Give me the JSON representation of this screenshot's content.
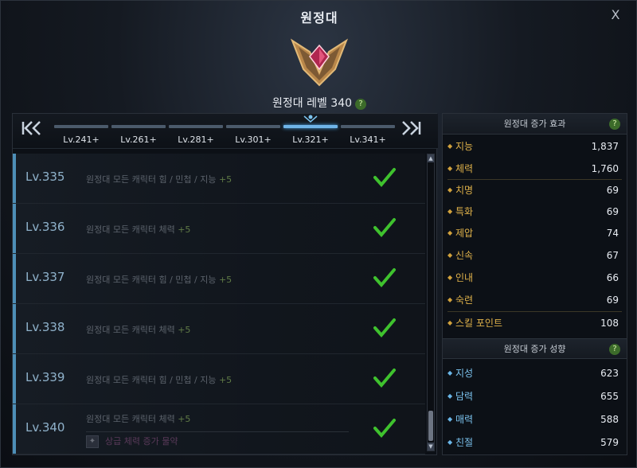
{
  "window": {
    "title": "원정대",
    "close_label": "X"
  },
  "header": {
    "level_text": "원정대 레벨 340",
    "help": "?"
  },
  "tabs": {
    "first": "K",
    "prev": "<",
    "next": ">",
    "last": "K",
    "items": [
      {
        "label": "Lv.241+"
      },
      {
        "label": "Lv.261+"
      },
      {
        "label": "Lv.281+"
      },
      {
        "label": "Lv.301+"
      },
      {
        "label": "Lv.321+",
        "active": true
      },
      {
        "label": "Lv.341+"
      }
    ]
  },
  "rows": [
    {
      "level": "Lv.335",
      "desc": "원정대 모든 캐릭터 힘 / 민첩 / 지능",
      "bonus": "+5",
      "done": true
    },
    {
      "level": "Lv.336",
      "desc": "원정대 모든 캐릭터 체력",
      "bonus": "+5",
      "done": true
    },
    {
      "level": "Lv.337",
      "desc": "원정대 모든 캐릭터 힘 / 민첩 / 지능",
      "bonus": "+5",
      "done": true
    },
    {
      "level": "Lv.338",
      "desc": "원정대 모든 캐릭터 체력",
      "bonus": "+5",
      "done": true
    },
    {
      "level": "Lv.339",
      "desc": "원정대 모든 캐릭터 힘 / 민첩 / 지능",
      "bonus": "+5",
      "done": true
    },
    {
      "level": "Lv.340",
      "desc": "원정대 모든 캐릭터 체력",
      "bonus": "+5",
      "done": true,
      "extra": "상급 체력 증가 물약"
    }
  ],
  "scrollbar": {
    "up": "▲",
    "down": "▼"
  },
  "effects": {
    "title": "원정대 증가 효과",
    "help": "?",
    "stats": [
      {
        "name": "지능",
        "value": "1,837"
      },
      {
        "name": "체력",
        "value": "1,760"
      },
      {
        "name": "치명",
        "value": "69"
      },
      {
        "name": "특화",
        "value": "69"
      },
      {
        "name": "제압",
        "value": "74"
      },
      {
        "name": "신속",
        "value": "67"
      },
      {
        "name": "인내",
        "value": "66"
      },
      {
        "name": "숙련",
        "value": "69"
      },
      {
        "name": "스킬 포인트",
        "value": "108"
      }
    ]
  },
  "tendencies": {
    "title": "원정대 증가 성향",
    "help": "?",
    "stats": [
      {
        "name": "지성",
        "value": "623"
      },
      {
        "name": "담력",
        "value": "655"
      },
      {
        "name": "매력",
        "value": "588"
      },
      {
        "name": "친절",
        "value": "579"
      }
    ]
  },
  "colors": {
    "accent": "#6fb4e8",
    "check": "#3fc22e",
    "gold": "#e0b24a"
  }
}
